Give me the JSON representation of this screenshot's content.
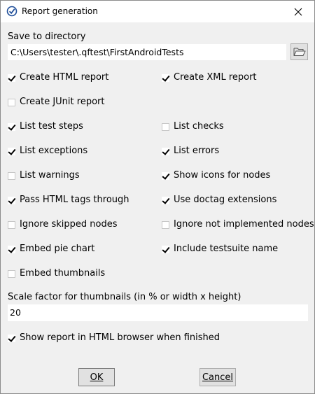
{
  "window": {
    "title": "Report generation"
  },
  "directory": {
    "label": "Save to directory",
    "value": "C:\\Users\\tester\\.qftest\\FirstAndroidTests"
  },
  "checkboxes": [
    {
      "key": "create_html",
      "label": "Create HTML report",
      "checked": true
    },
    {
      "key": "create_xml",
      "label": "Create XML report",
      "checked": true
    },
    {
      "key": "create_junit",
      "label": "Create JUnit report",
      "checked": false
    },
    {
      "key": "list_steps",
      "label": "List test steps",
      "checked": true
    },
    {
      "key": "list_checks",
      "label": "List checks",
      "checked": false
    },
    {
      "key": "list_exceptions",
      "label": "List exceptions",
      "checked": true
    },
    {
      "key": "list_errors",
      "label": "List errors",
      "checked": true
    },
    {
      "key": "list_warnings",
      "label": "List warnings",
      "checked": false
    },
    {
      "key": "show_icons",
      "label": "Show icons for nodes",
      "checked": true
    },
    {
      "key": "pass_html",
      "label": "Pass HTML tags through",
      "checked": true
    },
    {
      "key": "doctag",
      "label": "Use doctag extensions",
      "checked": true
    },
    {
      "key": "ignore_skipped",
      "label": "Ignore skipped nodes",
      "checked": false
    },
    {
      "key": "ignore_not_impl",
      "label": "Ignore not implemented nodes",
      "checked": false
    },
    {
      "key": "embed_pie",
      "label": "Embed pie chart",
      "checked": true
    },
    {
      "key": "include_suite",
      "label": "Include testsuite name",
      "checked": true
    },
    {
      "key": "embed_thumbs",
      "label": "Embed thumbnails",
      "checked": false
    },
    {
      "key": "show_browser",
      "label": "Show report in HTML browser when finished",
      "checked": true
    }
  ],
  "scale": {
    "label": "Scale factor for thumbnails (in % or width x height)",
    "value": "20"
  },
  "buttons": {
    "ok": "OK",
    "cancel": "Cancel"
  },
  "colors": {
    "title_bg": "#ffffff",
    "dialog_bg": "#f0f0f0",
    "button_bg": "#e1e1e1",
    "icon_blue": "#1f4e99"
  }
}
